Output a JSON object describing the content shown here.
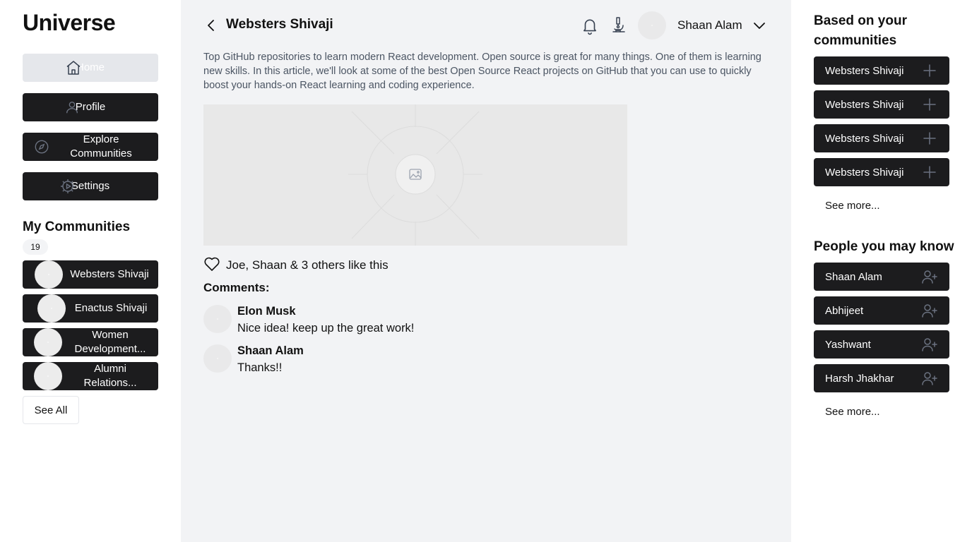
{
  "app": {
    "title": "Universe"
  },
  "nav": [
    {
      "label": "Home",
      "icon": "home-icon",
      "active": true
    },
    {
      "label": "Profile",
      "icon": "user-icon"
    },
    {
      "label": "Explore Communities",
      "icon": "compass-icon"
    },
    {
      "label": "Settings",
      "icon": "gear-icon"
    }
  ],
  "my_communities": {
    "title": "My Communities",
    "count": "19",
    "items": [
      {
        "label": "Websters Shivaji"
      },
      {
        "label": "Enactus Shivaji"
      },
      {
        "label": "Women Development..."
      },
      {
        "label": "Alumni Relations..."
      }
    ],
    "see_all_label": "See All"
  },
  "post": {
    "title": "Websters Shivaji",
    "body": "Top GitHub repositories to learn modern React development. Open source is great for many things. One of them is learning new skills. In this article, we'll look at some of the best Open Source React projects on GitHub that you can use to quickly boost your hands-on React learning and coding experience.",
    "likes_text": "Joe, Shaan & 3 others like this",
    "comments_title": "Comments:",
    "comments": [
      {
        "name": "Elon Musk",
        "text": "Nice idea! keep up the great work!"
      },
      {
        "name": "Shaan Alam",
        "text": "Thanks!!"
      }
    ]
  },
  "header": {
    "user_name": "Shaan Alam"
  },
  "suggested_communities": {
    "title": "Based on your communities",
    "items": [
      {
        "label": "Websters Shivaji"
      },
      {
        "label": "Websters Shivaji"
      },
      {
        "label": "Websters Shivaji"
      },
      {
        "label": "Websters Shivaji"
      }
    ],
    "see_more_label": "See more..."
  },
  "people": {
    "title": "People you may know",
    "items": [
      {
        "label": "Shaan Alam"
      },
      {
        "label": "Abhijeet"
      },
      {
        "label": "Yashwant"
      },
      {
        "label": "Harsh Jhakhar"
      }
    ],
    "see_more_label": "See more..."
  },
  "colors": {
    "dark_button": "#1c1c1e",
    "main_bg": "#f2f3f5",
    "placeholder": "#e8e8e8"
  }
}
